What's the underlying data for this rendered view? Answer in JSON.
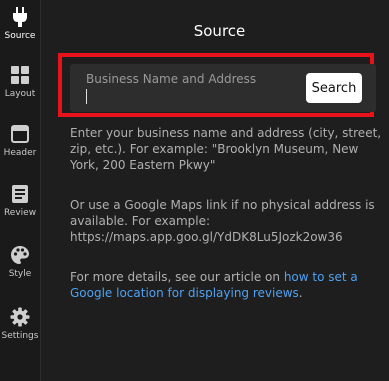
{
  "sidebar": {
    "items": [
      {
        "label": "Source",
        "icon": "plug-icon",
        "active": true
      },
      {
        "label": "Layout",
        "icon": "grid-icon",
        "active": false
      },
      {
        "label": "Header",
        "icon": "header-icon",
        "active": false
      },
      {
        "label": "Review",
        "icon": "review-icon",
        "active": false
      },
      {
        "label": "Style",
        "icon": "palette-icon",
        "active": false
      },
      {
        "label": "Settings",
        "icon": "gear-icon",
        "active": false
      }
    ]
  },
  "main": {
    "title": "Source",
    "search": {
      "placeholder": "Business Name and Address",
      "value": "",
      "button_label": "Search"
    },
    "help": {
      "paragraph1": "Enter your business name and address (city, street, zip, etc.). For example: \"Brooklyn Museum, New York, 200 Eastern Pkwy\"",
      "paragraph2": "Or use a Google Maps link if no physical address is available. For example: https://maps.app.goo.gl/YdDK8Lu5Jozk2ow36",
      "paragraph3_prefix": "For more details, see our article on ",
      "paragraph3_link": "how to set a Google location for displaying reviews",
      "paragraph3_suffix": "."
    }
  },
  "colors": {
    "background": "#1e1e1e",
    "sidebar": "#1a1a1a",
    "input_bg": "#2d2d2d",
    "highlight_border": "#e8121b",
    "link": "#4ea1f3",
    "button_bg": "#ffffff"
  }
}
